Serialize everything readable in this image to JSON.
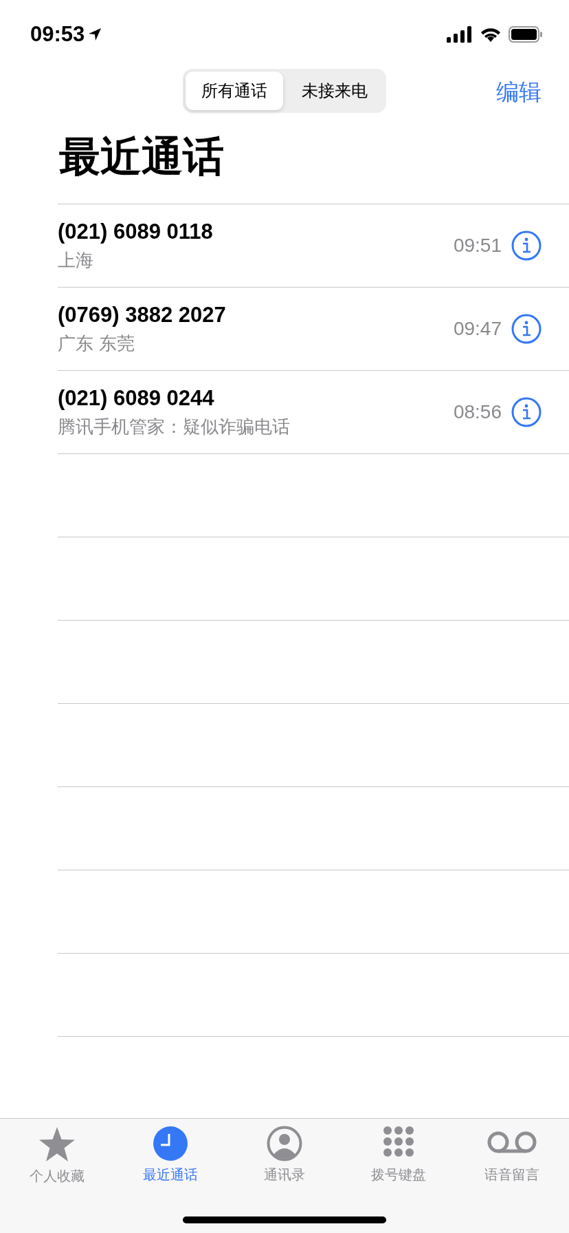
{
  "status_bar": {
    "time": "09:53"
  },
  "segments": [
    {
      "label": "所有通话",
      "selected": true
    },
    {
      "label": "未接来电",
      "selected": false
    }
  ],
  "edit_button": "编辑",
  "title": "最近通话",
  "calls": [
    {
      "number": "(021) 6089 0118",
      "subtitle": "上海",
      "time": "09:51"
    },
    {
      "number": "(0769) 3882 2027",
      "subtitle": "广东 东莞",
      "time": "09:47"
    },
    {
      "number": "(021) 6089 0244",
      "subtitle": "腾讯手机管家：疑似诈骗电话",
      "time": "08:56"
    }
  ],
  "tab_bar": [
    {
      "kind": "favorites",
      "label": "个人收藏",
      "selected": false
    },
    {
      "kind": "recents",
      "label": "最近通话",
      "selected": true
    },
    {
      "kind": "contacts",
      "label": "通讯录",
      "selected": false
    },
    {
      "kind": "keypad",
      "label": "拨号键盘",
      "selected": false
    },
    {
      "kind": "voicemail",
      "label": "语音留言",
      "selected": false
    }
  ]
}
